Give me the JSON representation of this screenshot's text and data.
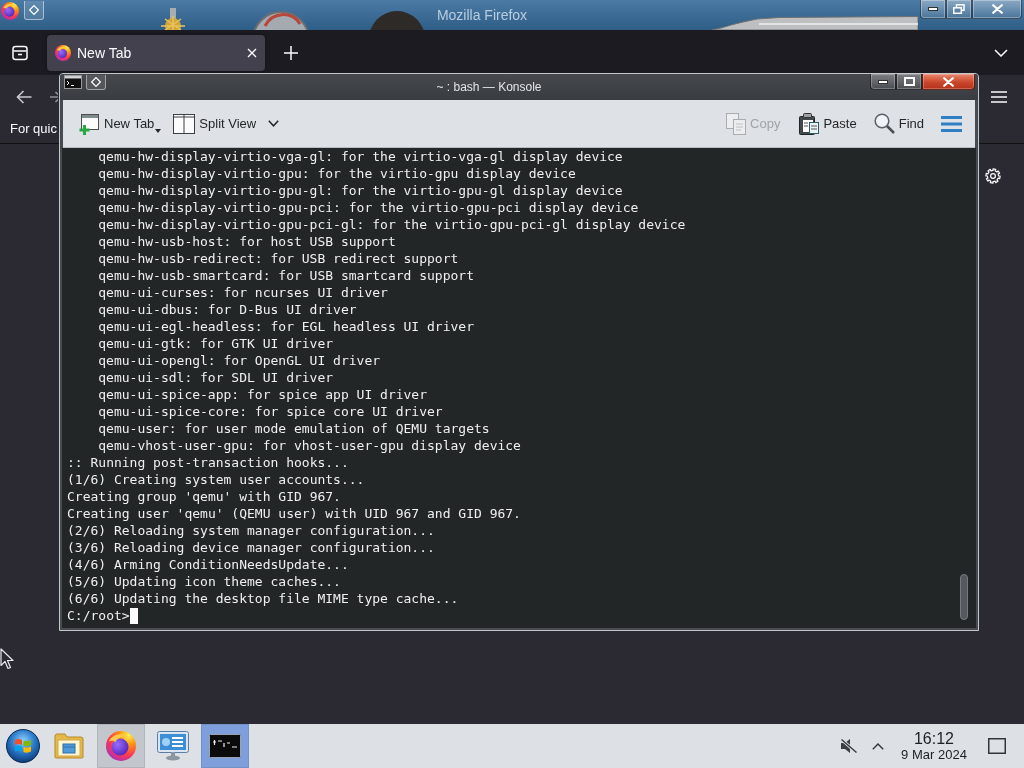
{
  "firefox": {
    "window": {
      "title": "Mozilla Firefox"
    },
    "tabs": [
      {
        "label": "New Tab",
        "selected": true
      }
    ],
    "bookmarks_toolbar": {
      "text": "For quic"
    }
  },
  "konsole": {
    "window": {
      "title": "~ : bash — Konsole"
    },
    "toolbar": {
      "left": [
        {
          "kind": "new-tab",
          "label": "New Tab",
          "disabled": false
        },
        {
          "kind": "split-view",
          "label": "Split View",
          "disabled": false
        }
      ],
      "right": [
        {
          "kind": "copy",
          "label": "Copy",
          "disabled": true
        },
        {
          "kind": "paste",
          "label": "Paste",
          "disabled": false
        },
        {
          "kind": "find",
          "label": "Find",
          "disabled": false
        },
        {
          "kind": "menu",
          "disabled": false
        }
      ]
    },
    "terminal": {
      "dependency_lines": [
        "qemu-hw-display-virtio-vga-gl: for the virtio-vga-gl display device",
        "qemu-hw-display-virtio-gpu: for the virtio-gpu display device",
        "qemu-hw-display-virtio-gpu-gl: for the virtio-gpu-gl display device",
        "qemu-hw-display-virtio-gpu-pci: for the virtio-gpu-pci display device",
        "qemu-hw-display-virtio-gpu-pci-gl: for the virtio-gpu-pci-gl display device",
        "qemu-hw-usb-host: for host USB support",
        "qemu-hw-usb-redirect: for USB redirect support",
        "qemu-hw-usb-smartcard: for USB smartcard support",
        "qemu-ui-curses: for ncurses UI driver",
        "qemu-ui-dbus: for D-Bus UI driver",
        "qemu-ui-egl-headless: for EGL headless UI driver",
        "qemu-ui-gtk: for GTK UI driver",
        "qemu-ui-opengl: for OpenGL UI driver",
        "qemu-ui-sdl: for SDL UI driver",
        "qemu-ui-spice-app: for spice app UI driver",
        "qemu-ui-spice-core: for spice core UI driver",
        "qemu-user: for user mode emulation of QEMU targets",
        "qemu-vhost-user-gpu: for vhost-user-gpu display device"
      ],
      "output_lines": [
        ":: Running post-transaction hooks...",
        "(1/6) Creating system user accounts...",
        "Creating group 'qemu' with GID 967.",
        "Creating user 'qemu' (QEMU user) with UID 967 and GID 967.",
        "(2/6) Reloading system manager configuration...",
        "(3/6) Reloading device manager configuration...",
        "(4/6) Arming ConditionNeedsUpdate...",
        "(5/6) Updating icon theme caches...",
        "(6/6) Updating the desktop file MIME type cache..."
      ],
      "prompt": "C:/root>"
    }
  },
  "taskbar": {
    "tasks": [
      {
        "kind": "files",
        "open": false,
        "selected": false
      },
      {
        "kind": "browser",
        "open": true,
        "selected": false
      },
      {
        "kind": "settings",
        "open": false,
        "selected": false
      },
      {
        "kind": "terminal",
        "open": true,
        "selected": true
      }
    ],
    "tray": {
      "muted": true
    },
    "clock": {
      "time": "16:12",
      "date": "9 Mar 2024"
    }
  }
}
